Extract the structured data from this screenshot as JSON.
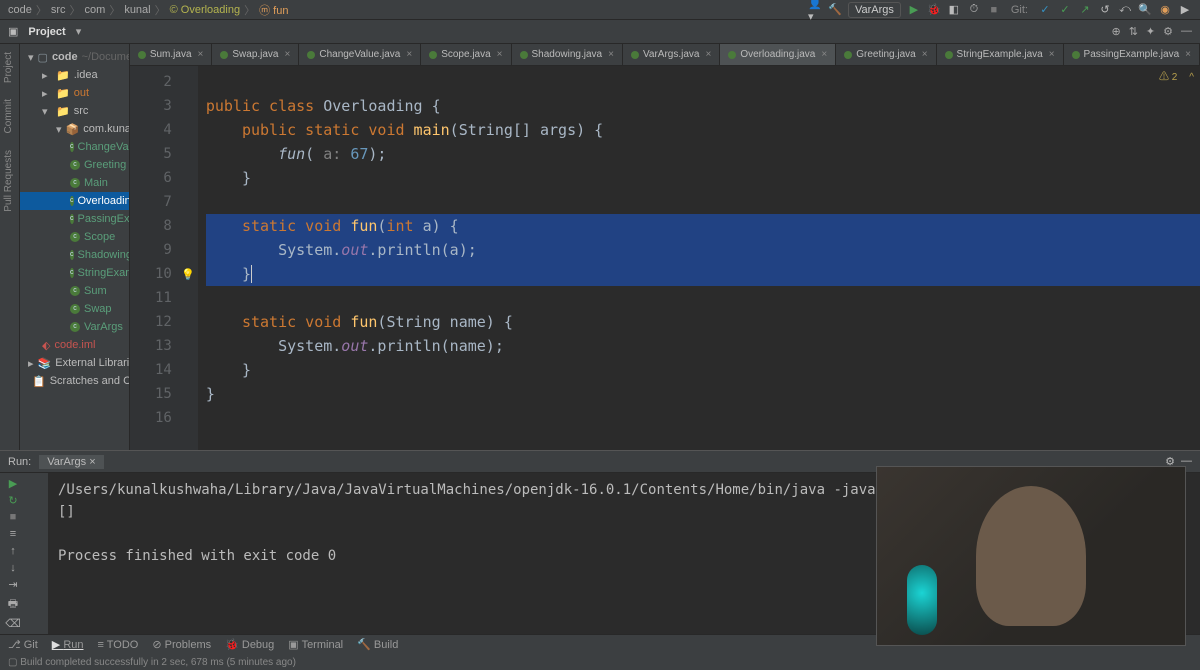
{
  "breadcrumb": {
    "p1": "code",
    "p2": "src",
    "p3": "com",
    "p4": "kunal",
    "p5": "Overloading",
    "p6": "fun"
  },
  "topbar": {
    "runconfig": "VarArgs",
    "gitlabel": "Git:"
  },
  "projbar": {
    "title": "Project"
  },
  "tree": {
    "root": "code",
    "rootPath": "~/Documents/Community Classroom/DS",
    "idea": ".idea",
    "out": "out",
    "src": "src",
    "pkg": "com.kunal",
    "f1": "ChangeValue",
    "f2": "Greeting",
    "f3": "Main",
    "f4": "Overloading",
    "f5": "PassingExample",
    "f6": "Scope",
    "f7": "Shadowing",
    "f8": "StringExample",
    "f9": "Sum",
    "f10": "Swap",
    "f11": "VarArgs",
    "iml": "code.iml",
    "ext": "External Libraries",
    "scratch": "Scratches and Consoles"
  },
  "tabs": {
    "t1": "Sum.java",
    "t2": "Swap.java",
    "t3": "ChangeValue.java",
    "t4": "Scope.java",
    "t5": "Shadowing.java",
    "t6": "VarArgs.java",
    "t7": "Overloading.java",
    "t8": "Greeting.java",
    "t9": "StringExample.java",
    "t10": "PassingExample.java"
  },
  "annot": "⚠ 2 ㅤ^",
  "gutter": {
    "l2": "2",
    "l3": "3",
    "l4": "4",
    "l5": "5",
    "l6": "6",
    "l7": "7",
    "l8": "8",
    "l9": "9",
    "l10": "10",
    "l11": "11",
    "l12": "12",
    "l13": "13",
    "l14": "14",
    "l15": "15",
    "l16": "16"
  },
  "code": {
    "l2": "",
    "l3_pre": "public class ",
    "l3_cls": "Overloading",
    "l3_post": " {",
    "l4_pre": "    ",
    "l4_k1": "public static void ",
    "l4_fn": "main",
    "l4_args": "(String[] args) {",
    "l5_pre": "        ",
    "l5_fn": "fun",
    "l5_p1": "( ",
    "l5_hint": "a: ",
    "l5_val": "67",
    "l5_p2": ");",
    "l6": "    }",
    "l7": "",
    "l8_pre": "    ",
    "l8_k": "static void ",
    "l8_fn": "fun",
    "l8_args": "(",
    "l8_t": "int ",
    "l8_v": "a",
    "l8_end": ") {",
    "l9_pre": "        System.",
    "l9_out": "out",
    "l9_post": ".println(a);",
    "l10": "    }",
    "l11": "",
    "l12_pre": "    ",
    "l12_k": "static void ",
    "l12_fn": "fun",
    "l12_args": "(String name) {",
    "l13_pre": "        System.",
    "l13_out": "out",
    "l13_post": ".println(name);",
    "l14": "    }",
    "l15": "}",
    "l16": ""
  },
  "run": {
    "label": "Run:",
    "tab": "VarArgs",
    "line1": "/Users/kunalkushwaha/Library/Java/JavaVirtualMachines/openjdk-16.0.1/Contents/Home/bin/java -javaagent:/Application",
    "line2": "[]",
    "line3": "",
    "line4": "Process finished with exit code 0"
  },
  "bottabs": {
    "git": "Git",
    "run": "Run",
    "todo": "TODO",
    "problems": "Problems",
    "debug": "Debug",
    "terminal": "Terminal",
    "build": "Build"
  },
  "status": "Build completed successfully in 2 sec, 678 ms (5 minutes ago)"
}
